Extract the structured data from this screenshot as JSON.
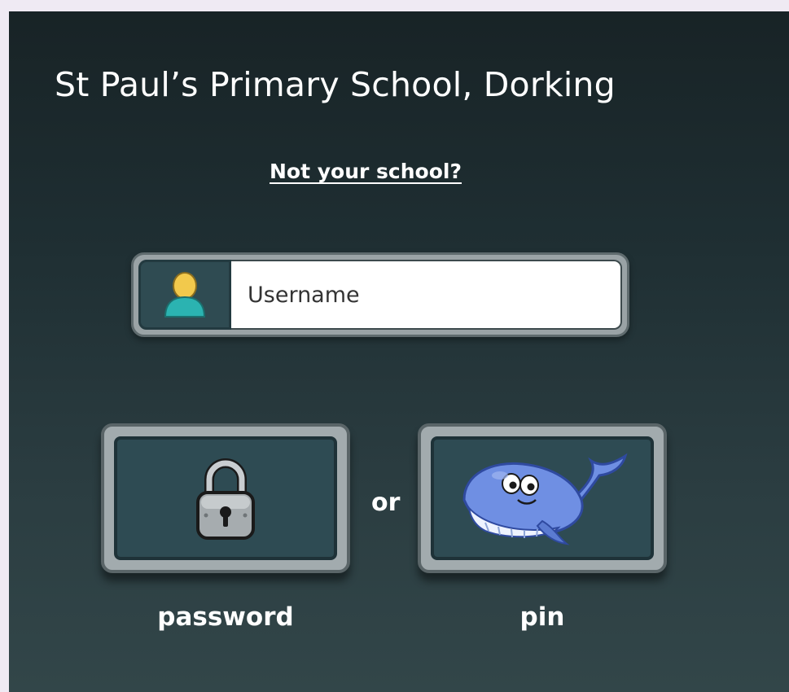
{
  "header": {
    "school_name": "St Paul’s Primary School, Dorking",
    "not_your_school_link": "Not your school?"
  },
  "login": {
    "username_placeholder": "Username",
    "username_value": "",
    "user_icon": "user-avatar-icon",
    "or_text": "or",
    "options": [
      {
        "label": "password",
        "icon": "padlock-icon"
      },
      {
        "label": "pin",
        "icon": "whale-icon"
      }
    ]
  },
  "colors": {
    "panel_bg": "#1f2f33",
    "button_face": "#2e4b53",
    "button_frame": "#a2abae",
    "text": "#ffffff"
  }
}
